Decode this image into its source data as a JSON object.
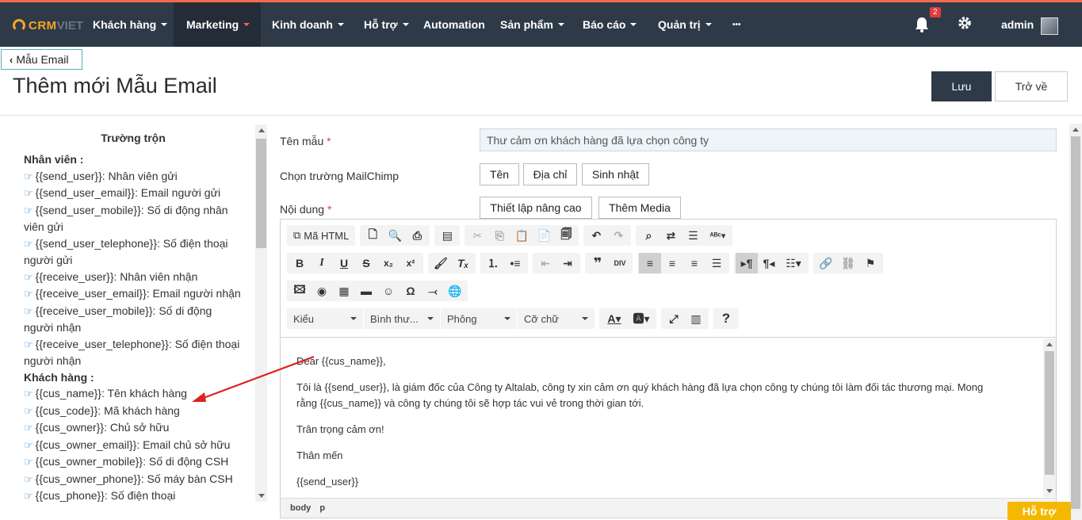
{
  "brand": {
    "logo_left": "CRM",
    "logo_right": "VIET"
  },
  "nav": {
    "items": [
      {
        "label": "Khách hàng",
        "caret": true
      },
      {
        "label": "Marketing",
        "caret": true,
        "active": true
      },
      {
        "label": "Kinh doanh",
        "caret": true
      },
      {
        "label": "Hỗ trợ",
        "caret": true
      },
      {
        "label": "Automation",
        "caret": false
      },
      {
        "label": "Sản phẩm",
        "caret": true
      },
      {
        "label": "Báo cáo",
        "caret": true
      },
      {
        "label": "Quản trị",
        "caret": true
      },
      {
        "label": "•••",
        "caret": false
      }
    ],
    "notification_count": "2",
    "user": "admin"
  },
  "page": {
    "back_label": "Mẫu Email",
    "title": "Thêm mới Mẫu Email",
    "save_label": "Lưu",
    "return_label": "Trở về"
  },
  "merge": {
    "title": "Trường trộn",
    "groups": [
      {
        "title": "Nhân viên :",
        "items": [
          "{{send_user}}: Nhân viên gửi",
          "{{send_user_email}}: Email người gửi",
          "{{send_user_mobile}}: Số di động nhân viên gửi",
          "{{send_user_telephone}}: Số điện thoại người gửi",
          "{{receive_user}}: Nhân viên nhận",
          "{{receive_user_email}}: Email người nhận",
          "{{receive_user_mobile}}: Số di động người nhận",
          "{{receive_user_telephone}}: Số điện thoại người nhận"
        ]
      },
      {
        "title": "Khách hàng :",
        "items": [
          "{{cus_name}}: Tên khách hàng",
          "{{cus_code}}: Mã khách hàng",
          "{{cus_owner}}: Chủ sở hữu",
          "{{cus_owner_email}}: Email chủ sở hữu",
          "{{cus_owner_mobile}}: Số di động CSH",
          "{{cus_owner_phone}}: Số máy bàn CSH",
          "{{cus_phone}}: Số điện thoại"
        ]
      }
    ]
  },
  "form": {
    "name_label": "Tên mẫu",
    "name_value": "Thư cảm ơn khách hàng đã lựa chọn công ty",
    "mailchimp_label": "Chọn trường MailChimp",
    "mailchimp_buttons": [
      "Tên",
      "Địa chỉ",
      "Sinh nhật"
    ],
    "content_label": "Nội dung",
    "advanced_label": "Thiết lập nâng cao",
    "media_label": "Thêm Media",
    "required_mark": "*"
  },
  "editor": {
    "source_label": "Mã HTML",
    "combos": [
      "Kiểu",
      "Bình thư...",
      "Phông",
      "Cỡ chữ"
    ],
    "body": [
      "Dear {{cus_name}},",
      "Tôi là {{send_user}}, là giám đốc của Công ty Altalab, công ty xin cảm ơn quý khách hàng đã lựa chọn công ty chúng tôi làm đối tác thương mại. Mong rằng {{cus_name}} và công ty chúng tôi sẽ hợp tác vui vẻ trong thời gian tới.",
      "Trân trọng cảm ơn!",
      "Thân mến",
      "{{send_user}}"
    ],
    "path": [
      "body",
      "p"
    ]
  },
  "support_label": "Hỗ trợ"
}
